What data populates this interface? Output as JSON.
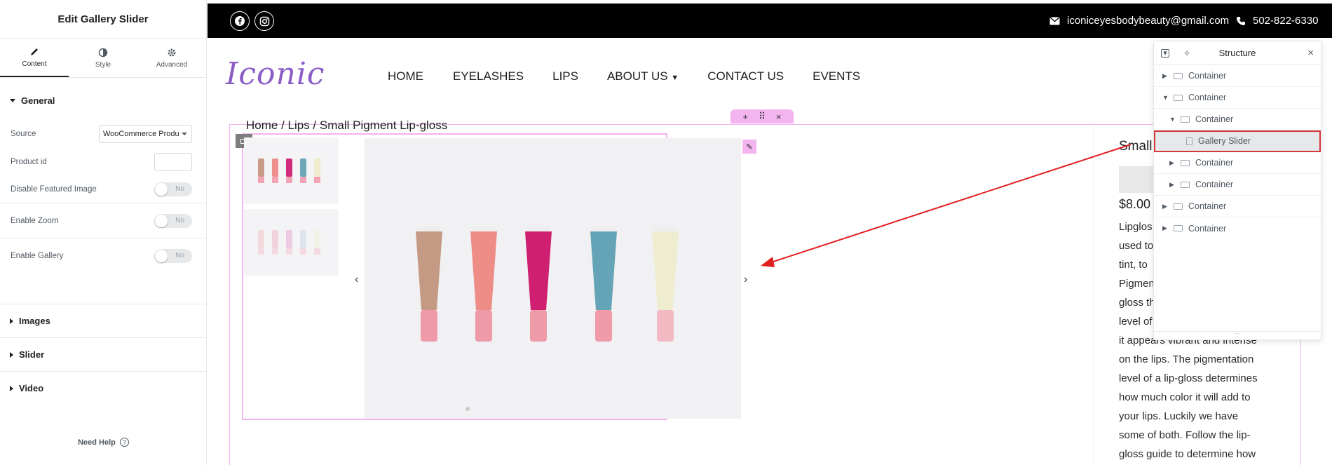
{
  "panel": {
    "title": "Edit Gallery Slider",
    "tabs": [
      {
        "label": "Content",
        "icon": "pencil-icon",
        "active": true
      },
      {
        "label": "Style",
        "icon": "half-circle-icon",
        "active": false
      },
      {
        "label": "Advanced",
        "icon": "gear-icon",
        "active": false
      }
    ],
    "general_label": "General",
    "source_label": "Source",
    "source_value": "WooCommerce Product",
    "product_id_label": "Product id",
    "disable_featured_label": "Disable Featured Image",
    "disable_featured_value": "No",
    "zoom_label": "Enable Zoom",
    "zoom_value": "No",
    "gallery_label": "Enable Gallery",
    "gallery_value": "No",
    "images_label": "Images",
    "slider_label": "Slider",
    "video_label": "Video",
    "help_label": "Need Help",
    "help_icon": "?"
  },
  "site": {
    "email": "iconiceyesbodybeauty@gmail.com",
    "phone": "502-822-6330",
    "logo": "Iconic",
    "nav": [
      "HOME",
      "EYELASHES",
      "LIPS",
      "ABOUT US",
      "CONTACT US",
      "EVENTS"
    ],
    "breadcrumb": "Home / Lips / Small Pigment Lip-gloss",
    "product_title": "Small",
    "price": "$8.00",
    "desc_lines": [
      "Lipglos",
      "used to",
      "tint, to",
      "Pigmen",
      "gloss th",
      "level of",
      "it appears vibrant and intense",
      "on the lips. The pigmentation",
      "level of a lip-gloss determines",
      "how much color it will add to",
      "your lips. Luckily we have",
      "some of both.  Follow the lip-",
      "gloss guide to determine how"
    ],
    "tool_add": "+",
    "tool_move": "⠿",
    "tool_close": "×"
  },
  "structure": {
    "title": "Structure",
    "rows": [
      {
        "label": "Container",
        "indent": 0,
        "chevron": "right"
      },
      {
        "label": "Container",
        "indent": 0,
        "chevron": "down"
      },
      {
        "label": "Container",
        "indent": 1,
        "chevron": "down"
      },
      {
        "label": "Gallery Slider",
        "indent": 2,
        "chevron": "none",
        "selected": true
      },
      {
        "label": "Container",
        "indent": 1,
        "chevron": "right"
      },
      {
        "label": "Container",
        "indent": 1,
        "chevron": "right"
      },
      {
        "label": "Container",
        "indent": 0,
        "chevron": "right"
      },
      {
        "label": "Container",
        "indent": 0,
        "chevron": "right"
      }
    ]
  },
  "colors": {
    "accent_pink": "#f3b4ef",
    "highlight_red": "#d63638",
    "logo_purple": "#8b5cc7"
  }
}
